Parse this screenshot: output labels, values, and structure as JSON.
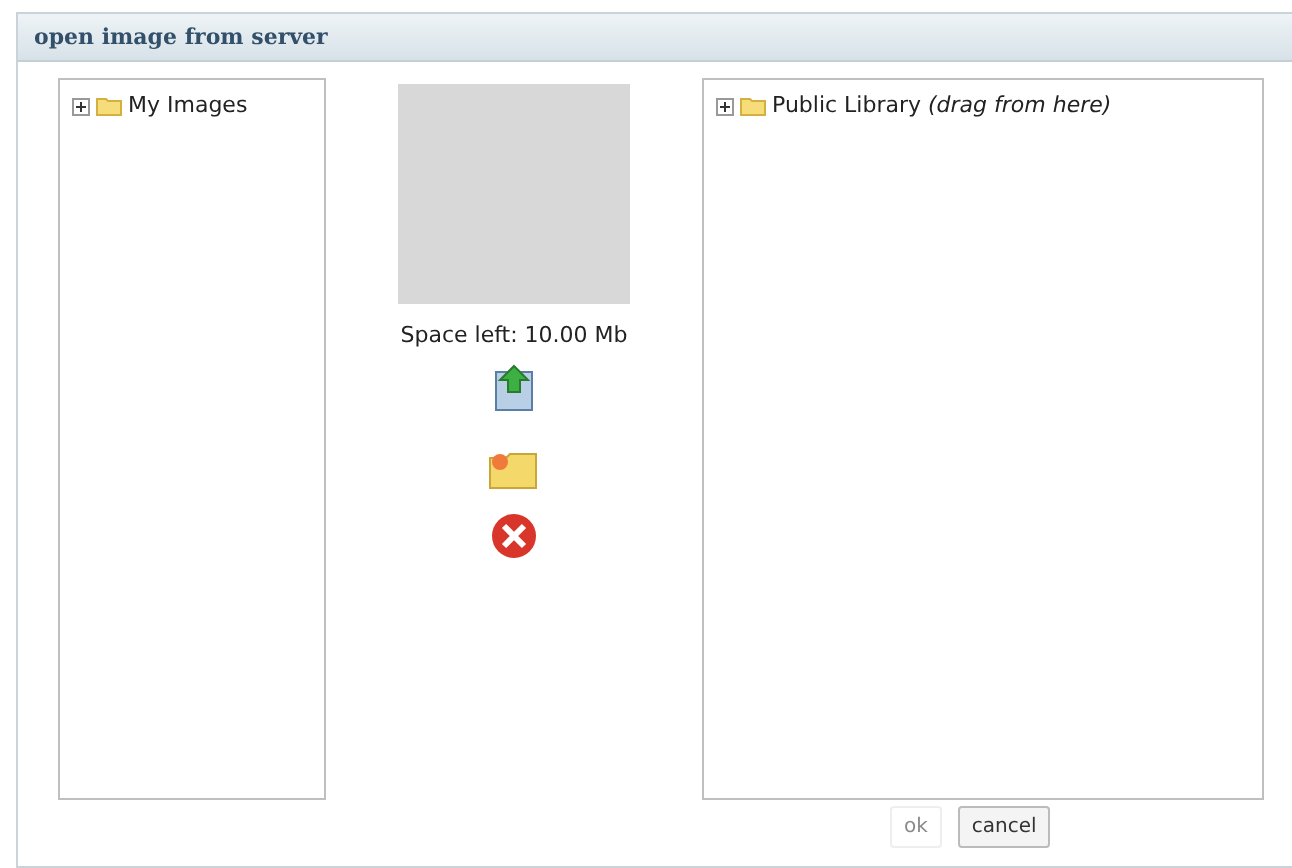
{
  "window": {
    "title": "open image from server"
  },
  "left_tree": [
    {
      "label": "My Images",
      "expanded": false
    }
  ],
  "preview": {
    "space_left": "Space left: 10.00 Mb"
  },
  "right_tree": [
    {
      "label": "Public Library *(drag from here)*",
      "expanded": false
    }
  ],
  "buttons": [
    {
      "label": "ok",
      "disabled": true
    },
    {
      "label": "cancel",
      "disabled": false
    }
  ]
}
